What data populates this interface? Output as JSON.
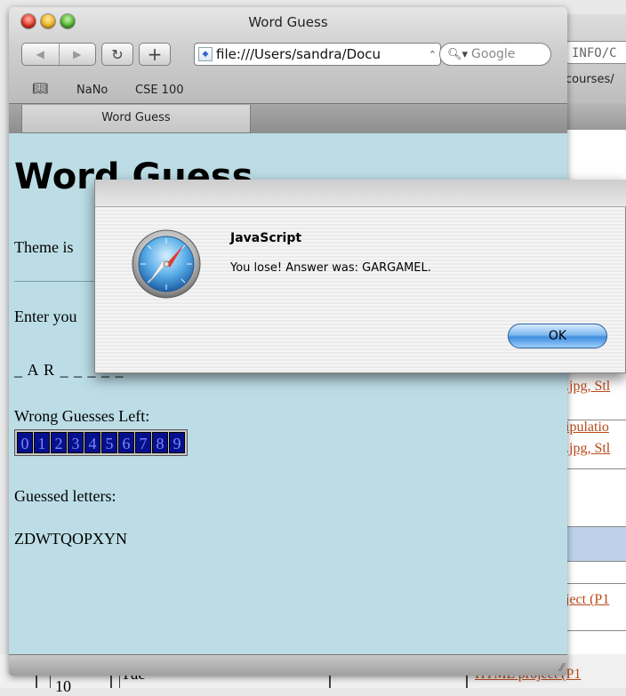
{
  "browser": {
    "window_title": "Word Guess",
    "address": "file:///Users/sandra/Docu",
    "search_placeholder": "Google",
    "bookmarks": [
      "NaNo",
      "CSE 100"
    ],
    "tab_label": "Word Guess"
  },
  "background_window": {
    "address_fragment": "INFO/C",
    "bookmark_fragment": "courses/",
    "links": [
      ".jpg, Stl",
      "ipulatio",
      ".jpg, Stl",
      "ject (P1",
      "HTML project (P1"
    ],
    "cells": [
      "10",
      "Tue"
    ]
  },
  "page": {
    "heading": "Word Guess",
    "theme_text": "Theme is",
    "enter_text": "Enter you",
    "word_progress": "_ A R _ _ _ _ _",
    "wrong_label": "Wrong Guesses Left:",
    "digits": [
      "0",
      "1",
      "2",
      "3",
      "4",
      "5",
      "6",
      "7",
      "8",
      "9"
    ],
    "guessed_label": "Guessed letters:",
    "guessed_letters": "ZDWTQOPXYN"
  },
  "dialog": {
    "title": "JavaScript",
    "message": "You lose! Answer was: GARGAMEL.",
    "ok_label": "OK"
  },
  "colors": {
    "page_background": "#bcdde6",
    "digit_cell": "#05118c",
    "link": "#b84a1a"
  }
}
